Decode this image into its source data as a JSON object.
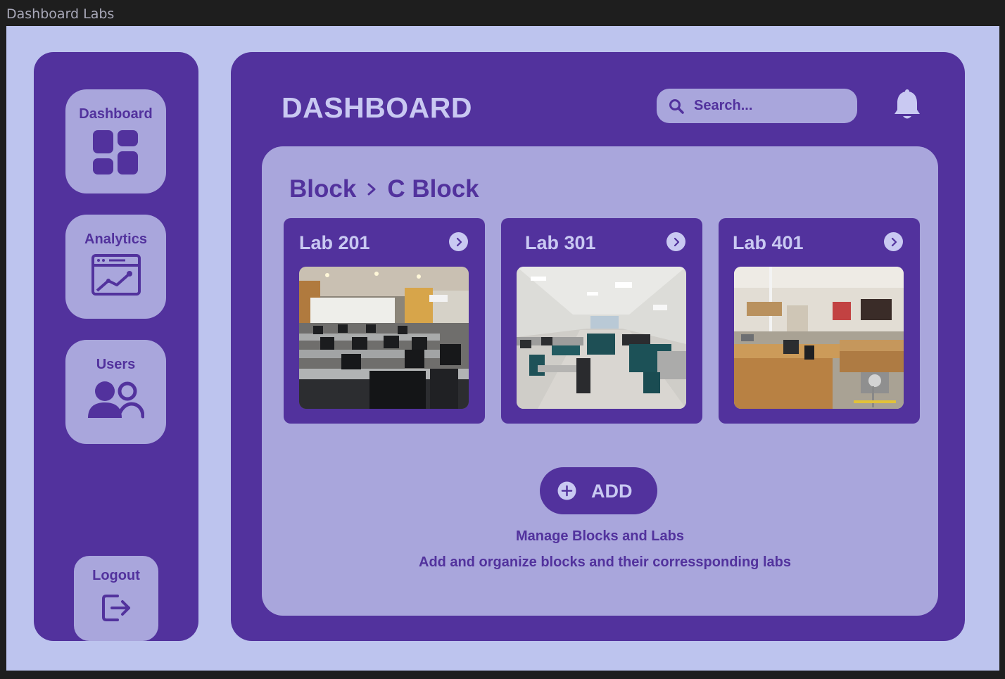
{
  "window": {
    "title": "Dashboard Labs"
  },
  "sidebar": {
    "items": [
      {
        "label": "Dashboard",
        "icon": "grid-icon"
      },
      {
        "label": "Analytics",
        "icon": "chart-window-icon"
      },
      {
        "label": "Users",
        "icon": "users-icon"
      }
    ],
    "logout": {
      "label": "Logout",
      "icon": "logout-icon"
    }
  },
  "header": {
    "title": "DASHBOARD",
    "search_placeholder": "Search...",
    "bell_icon": "bell-icon"
  },
  "breadcrumb": {
    "parent": "Block",
    "current": "C Block"
  },
  "labs": [
    {
      "name": "Lab 201",
      "photo": "computer-lab-rows-photo"
    },
    {
      "name": "Lab 301",
      "photo": "computer-lab-wide-photo"
    },
    {
      "name": "Lab 401",
      "photo": "science-lab-benches-photo"
    }
  ],
  "actions": {
    "add_label": "ADD"
  },
  "footer": {
    "heading": "Manage Blocks and Labs",
    "description": "Add and organize blocks and their corressponding labs"
  },
  "colors": {
    "background": "#bdc4ee",
    "primary": "#52329d",
    "panel": "#a9a6dc",
    "text_light": "#c9c9f2",
    "titlebar": "#1e1e1e"
  }
}
